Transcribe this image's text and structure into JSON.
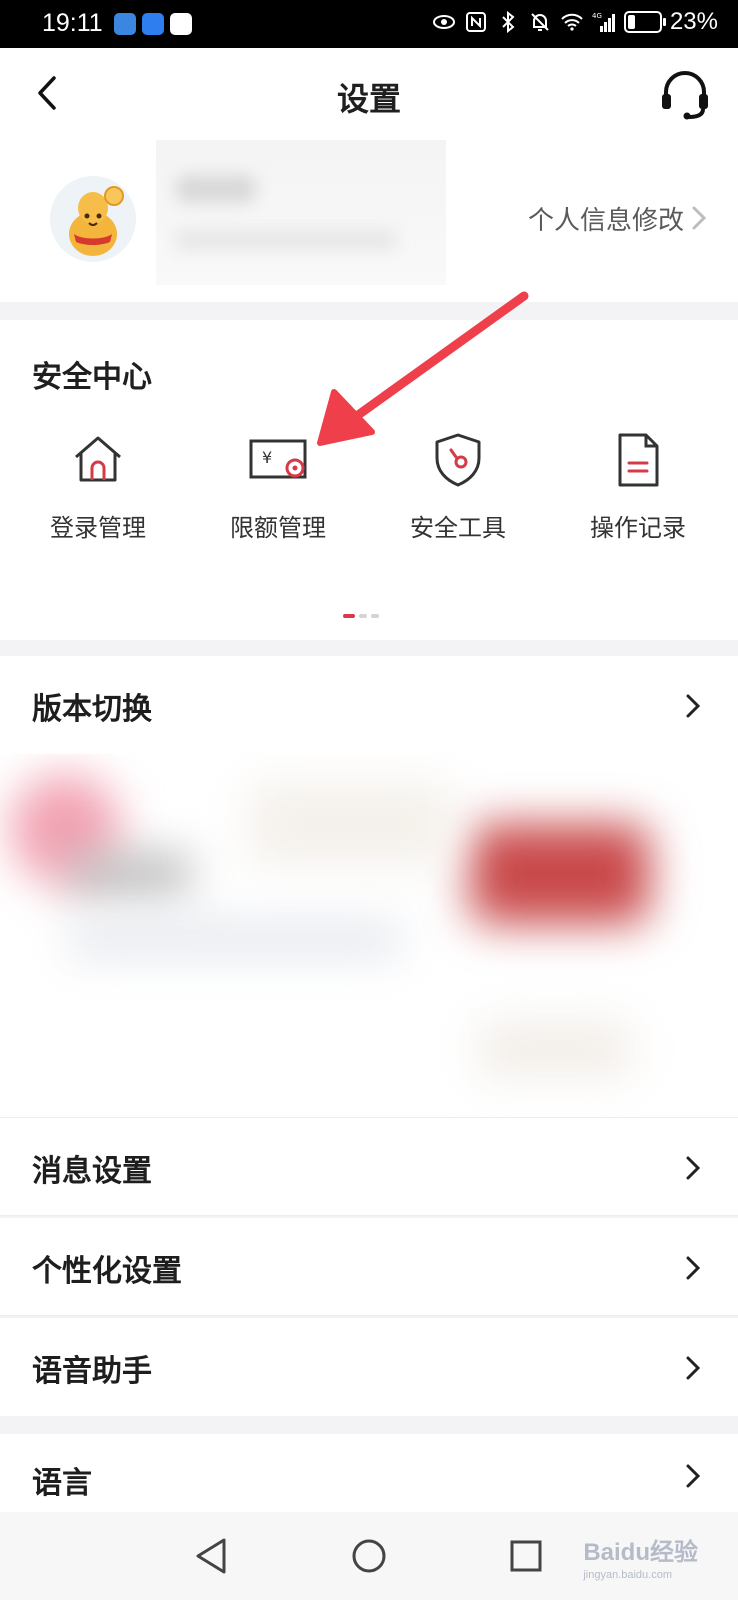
{
  "status_bar": {
    "time": "19:11",
    "network": "4G",
    "battery": "23%",
    "battery_level": 0.23
  },
  "header": {
    "title": "设置",
    "back_icon": "chevron-left-icon",
    "service_icon": "headset-icon"
  },
  "profile": {
    "edit_label": "个人信息修改",
    "avatar_icon": "gourd-mascot-avatar"
  },
  "security_center": {
    "title": "安全中心",
    "items": [
      {
        "label": "登录管理",
        "icon": "house-icon"
      },
      {
        "label": "限额管理",
        "icon": "yuan-card-limit-icon"
      },
      {
        "label": "安全工具",
        "icon": "shield-icon"
      },
      {
        "label": "操作记录",
        "icon": "document-icon"
      }
    ],
    "pages": 3,
    "current_page": 1
  },
  "rows": {
    "version_switch": "版本切换",
    "message_settings": "消息设置",
    "personalization": "个性化设置",
    "voice_assistant": "语音助手",
    "language": "语言"
  },
  "watermark": {
    "brand": "Baidu经验",
    "url": "jingyan.baidu.com"
  },
  "colors": {
    "accent": "#d63a48",
    "arrow": "#ee3f4a",
    "text": "#1f1f1f",
    "background": "#f3f3f5"
  }
}
